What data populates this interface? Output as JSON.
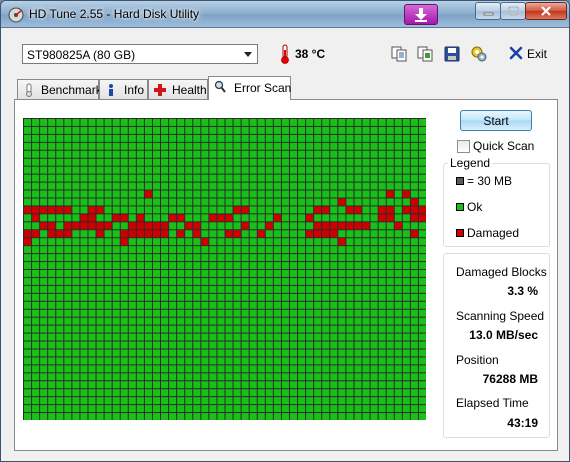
{
  "window": {
    "title": "HD Tune 2.55 - Hard Disk Utility"
  },
  "toolbar": {
    "drive": "ST980825A (80 GB)",
    "temperature": "38 °C",
    "icons": [
      "copy-text-icon",
      "copy-screenshot-icon",
      "save-icon",
      "options-icon"
    ],
    "exit_label": "Exit"
  },
  "tabs": [
    {
      "label": "Benchmark",
      "icon": "thermometer-tab-icon",
      "active": false
    },
    {
      "label": "Info",
      "icon": "info-icon",
      "active": false
    },
    {
      "label": "Health",
      "icon": "health-cross-icon",
      "active": false
    },
    {
      "label": "Error Scan",
      "icon": "magnifier-icon",
      "active": true
    }
  ],
  "controls": {
    "start_label": "Start",
    "quick_scan_label": "Quick Scan",
    "quick_scan_checked": false
  },
  "legend": {
    "title": "Legend",
    "items": [
      {
        "label": "= 30 MB",
        "color": "#5a5a5a"
      },
      {
        "label": "Ok",
        "color": "#18c018"
      },
      {
        "label": "Damaged",
        "color": "#d00000"
      }
    ]
  },
  "stats": {
    "damaged_blocks_label": "Damaged Blocks",
    "damaged_blocks_value": "3.3 %",
    "scanning_speed_label": "Scanning Speed",
    "scanning_speed_value": "13.0 MB/sec",
    "position_label": "Position",
    "position_value": "76288 MB",
    "elapsed_time_label": "Elapsed Time",
    "elapsed_time_value": "43:19"
  },
  "block_map": {
    "columns": 50,
    "rows": 38,
    "ok_color": "#18c018",
    "damaged_color": "#d00000",
    "grid_color": "#2d2d2d",
    "damaged_blocks": [
      [
        15,
        9
      ],
      [
        45,
        9
      ],
      [
        47,
        9
      ],
      [
        39,
        10
      ],
      [
        48,
        10
      ],
      [
        0,
        11
      ],
      [
        1,
        11
      ],
      [
        2,
        11
      ],
      [
        3,
        11
      ],
      [
        4,
        11
      ],
      [
        5,
        11
      ],
      [
        8,
        11
      ],
      [
        9,
        11
      ],
      [
        26,
        11
      ],
      [
        27,
        11
      ],
      [
        36,
        11
      ],
      [
        37,
        11
      ],
      [
        40,
        11
      ],
      [
        41,
        11
      ],
      [
        44,
        11
      ],
      [
        45,
        11
      ],
      [
        47,
        11
      ],
      [
        48,
        11
      ],
      [
        49,
        11
      ],
      [
        1,
        12
      ],
      [
        7,
        12
      ],
      [
        8,
        12
      ],
      [
        11,
        12
      ],
      [
        12,
        12
      ],
      [
        14,
        12
      ],
      [
        18,
        12
      ],
      [
        19,
        12
      ],
      [
        23,
        12
      ],
      [
        24,
        12
      ],
      [
        25,
        12
      ],
      [
        31,
        12
      ],
      [
        35,
        12
      ],
      [
        44,
        12
      ],
      [
        45,
        12
      ],
      [
        48,
        12
      ],
      [
        49,
        12
      ],
      [
        2,
        13
      ],
      [
        3,
        13
      ],
      [
        5,
        13
      ],
      [
        6,
        13
      ],
      [
        7,
        13
      ],
      [
        8,
        13
      ],
      [
        9,
        13
      ],
      [
        10,
        13
      ],
      [
        13,
        13
      ],
      [
        14,
        13
      ],
      [
        15,
        13
      ],
      [
        16,
        13
      ],
      [
        17,
        13
      ],
      [
        20,
        13
      ],
      [
        21,
        13
      ],
      [
        27,
        13
      ],
      [
        30,
        13
      ],
      [
        36,
        13
      ],
      [
        37,
        13
      ],
      [
        38,
        13
      ],
      [
        39,
        13
      ],
      [
        40,
        13
      ],
      [
        41,
        13
      ],
      [
        42,
        13
      ],
      [
        46,
        13
      ],
      [
        0,
        14
      ],
      [
        1,
        14
      ],
      [
        3,
        14
      ],
      [
        4,
        14
      ],
      [
        5,
        14
      ],
      [
        9,
        14
      ],
      [
        12,
        14
      ],
      [
        13,
        14
      ],
      [
        14,
        14
      ],
      [
        15,
        14
      ],
      [
        16,
        14
      ],
      [
        17,
        14
      ],
      [
        19,
        14
      ],
      [
        21,
        14
      ],
      [
        25,
        14
      ],
      [
        26,
        14
      ],
      [
        29,
        14
      ],
      [
        35,
        14
      ],
      [
        36,
        14
      ],
      [
        37,
        14
      ],
      [
        38,
        14
      ],
      [
        48,
        14
      ],
      [
        0,
        15
      ],
      [
        12,
        15
      ],
      [
        22,
        15
      ],
      [
        39,
        15
      ]
    ]
  }
}
